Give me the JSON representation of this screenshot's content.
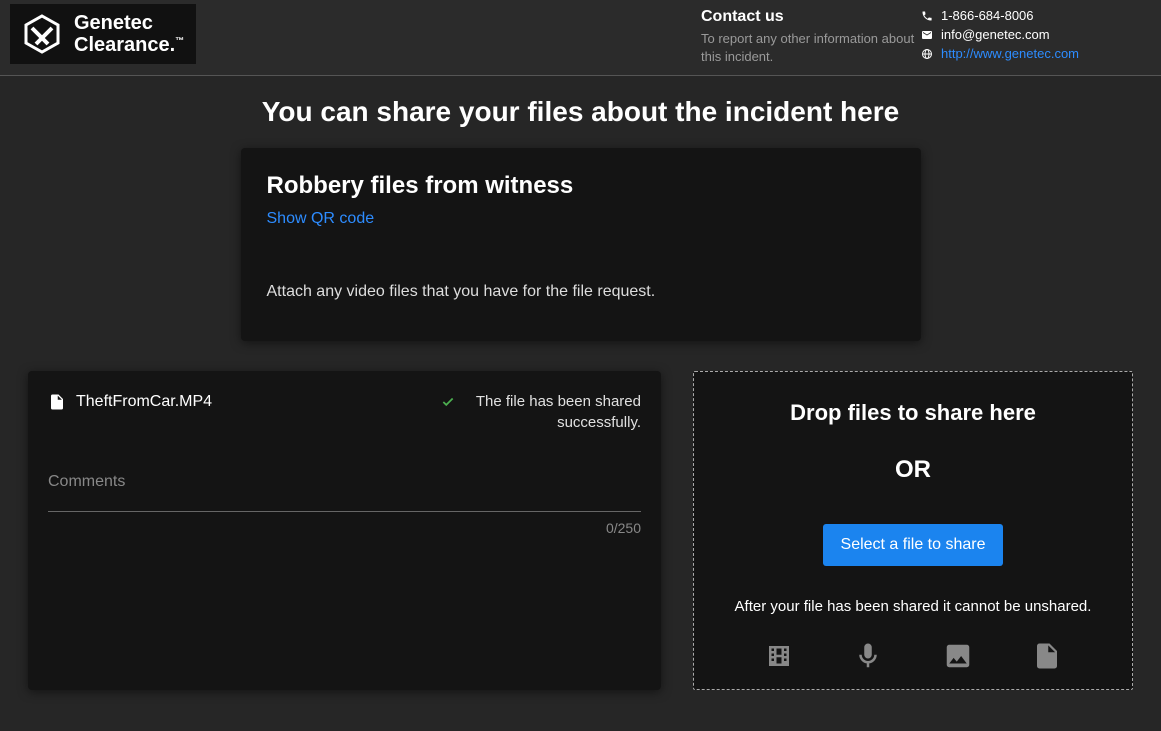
{
  "header": {
    "logo_line1": "Genetec",
    "logo_line2": "Clearance.",
    "contact_title": "Contact us",
    "contact_desc": "To report any other information about this incident.",
    "phone": "1-866-684-8006",
    "email": "info@genetec.com",
    "website": "http://www.genetec.com"
  },
  "main": {
    "title": "You can share your files about the incident here"
  },
  "request": {
    "title": "Robbery files from witness",
    "qr_link": "Show QR code",
    "description": "Attach any video files that you have for the file request."
  },
  "file": {
    "name": "TheftFromCar.MP4",
    "status": "The file has been shared successfully.",
    "comments_label": "Comments",
    "char_count": "0/250"
  },
  "drop": {
    "title": "Drop files to share here",
    "or": "OR",
    "button": "Select a file to share",
    "note": "After your file has been shared it cannot be unshared."
  },
  "colors": {
    "link": "#2d8cff",
    "primary": "#1b84ef",
    "success": "#4caf50"
  }
}
